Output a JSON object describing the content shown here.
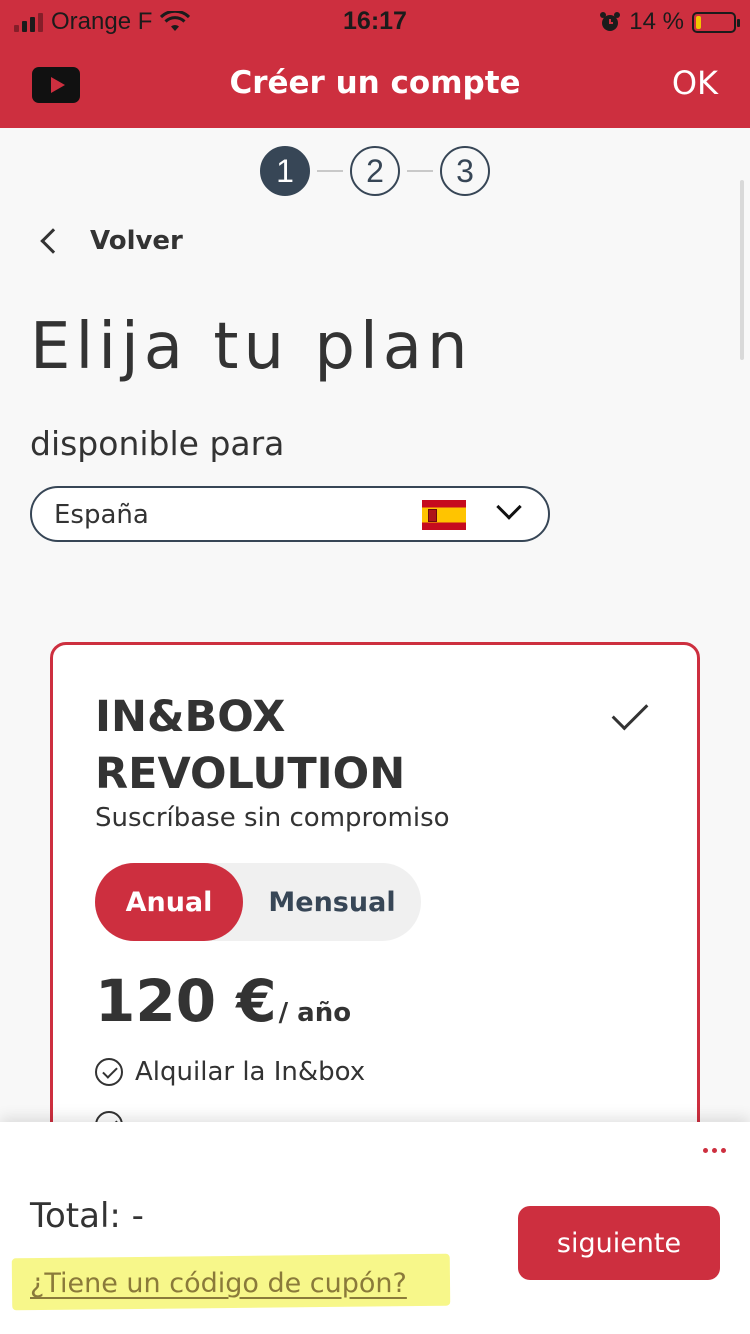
{
  "status_bar": {
    "carrier": "Orange F",
    "time": "16:17",
    "battery": "14 %",
    "battery_level": 0.14
  },
  "nav": {
    "title": "Créer un compte",
    "ok_label": "OK"
  },
  "stepper": {
    "steps": [
      "1",
      "2",
      "3"
    ],
    "active_step": 1
  },
  "back_label": "Volver",
  "page_title": "Elija tu plan",
  "availability_label": "disponible para",
  "country": {
    "selected": "España",
    "flag_icon": "spain-flag-icon"
  },
  "plan": {
    "name": "IN&BOX REVOLUTION",
    "subtitle": "Suscríbase sin compromiso",
    "selected": true,
    "billing": {
      "annual_label": "Anual",
      "monthly_label": "Mensual",
      "active": "annual"
    },
    "price": {
      "amount": "120 €",
      "period": "/ año"
    },
    "features": [
      "Alquilar la In&box"
    ]
  },
  "footer": {
    "total_label": "Total: -",
    "coupon_link": "¿Tiene un código de cupón?",
    "next_label": "siguiente"
  },
  "colors": {
    "brand_red": "#cd2f3f",
    "slate": "#374656",
    "highlight_yellow": "#f7f78a"
  }
}
